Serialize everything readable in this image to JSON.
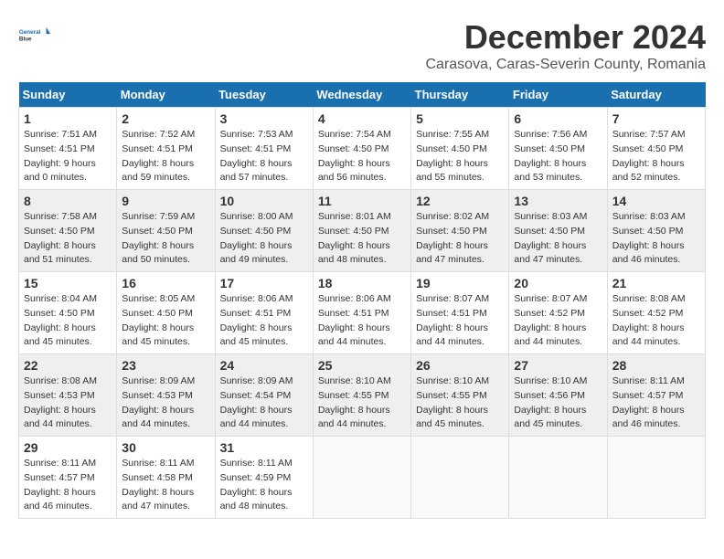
{
  "header": {
    "logo_line1": "General",
    "logo_line2": "Blue",
    "month": "December 2024",
    "location": "Carasova, Caras-Severin County, Romania"
  },
  "days_of_week": [
    "Sunday",
    "Monday",
    "Tuesday",
    "Wednesday",
    "Thursday",
    "Friday",
    "Saturday"
  ],
  "weeks": [
    [
      {
        "day": "1",
        "sunrise": "Sunrise: 7:51 AM",
        "sunset": "Sunset: 4:51 PM",
        "daylight": "Daylight: 9 hours and 0 minutes."
      },
      {
        "day": "2",
        "sunrise": "Sunrise: 7:52 AM",
        "sunset": "Sunset: 4:51 PM",
        "daylight": "Daylight: 8 hours and 59 minutes."
      },
      {
        "day": "3",
        "sunrise": "Sunrise: 7:53 AM",
        "sunset": "Sunset: 4:51 PM",
        "daylight": "Daylight: 8 hours and 57 minutes."
      },
      {
        "day": "4",
        "sunrise": "Sunrise: 7:54 AM",
        "sunset": "Sunset: 4:50 PM",
        "daylight": "Daylight: 8 hours and 56 minutes."
      },
      {
        "day": "5",
        "sunrise": "Sunrise: 7:55 AM",
        "sunset": "Sunset: 4:50 PM",
        "daylight": "Daylight: 8 hours and 55 minutes."
      },
      {
        "day": "6",
        "sunrise": "Sunrise: 7:56 AM",
        "sunset": "Sunset: 4:50 PM",
        "daylight": "Daylight: 8 hours and 53 minutes."
      },
      {
        "day": "7",
        "sunrise": "Sunrise: 7:57 AM",
        "sunset": "Sunset: 4:50 PM",
        "daylight": "Daylight: 8 hours and 52 minutes."
      }
    ],
    [
      {
        "day": "8",
        "sunrise": "Sunrise: 7:58 AM",
        "sunset": "Sunset: 4:50 PM",
        "daylight": "Daylight: 8 hours and 51 minutes."
      },
      {
        "day": "9",
        "sunrise": "Sunrise: 7:59 AM",
        "sunset": "Sunset: 4:50 PM",
        "daylight": "Daylight: 8 hours and 50 minutes."
      },
      {
        "day": "10",
        "sunrise": "Sunrise: 8:00 AM",
        "sunset": "Sunset: 4:50 PM",
        "daylight": "Daylight: 8 hours and 49 minutes."
      },
      {
        "day": "11",
        "sunrise": "Sunrise: 8:01 AM",
        "sunset": "Sunset: 4:50 PM",
        "daylight": "Daylight: 8 hours and 48 minutes."
      },
      {
        "day": "12",
        "sunrise": "Sunrise: 8:02 AM",
        "sunset": "Sunset: 4:50 PM",
        "daylight": "Daylight: 8 hours and 47 minutes."
      },
      {
        "day": "13",
        "sunrise": "Sunrise: 8:03 AM",
        "sunset": "Sunset: 4:50 PM",
        "daylight": "Daylight: 8 hours and 47 minutes."
      },
      {
        "day": "14",
        "sunrise": "Sunrise: 8:03 AM",
        "sunset": "Sunset: 4:50 PM",
        "daylight": "Daylight: 8 hours and 46 minutes."
      }
    ],
    [
      {
        "day": "15",
        "sunrise": "Sunrise: 8:04 AM",
        "sunset": "Sunset: 4:50 PM",
        "daylight": "Daylight: 8 hours and 45 minutes."
      },
      {
        "day": "16",
        "sunrise": "Sunrise: 8:05 AM",
        "sunset": "Sunset: 4:50 PM",
        "daylight": "Daylight: 8 hours and 45 minutes."
      },
      {
        "day": "17",
        "sunrise": "Sunrise: 8:06 AM",
        "sunset": "Sunset: 4:51 PM",
        "daylight": "Daylight: 8 hours and 45 minutes."
      },
      {
        "day": "18",
        "sunrise": "Sunrise: 8:06 AM",
        "sunset": "Sunset: 4:51 PM",
        "daylight": "Daylight: 8 hours and 44 minutes."
      },
      {
        "day": "19",
        "sunrise": "Sunrise: 8:07 AM",
        "sunset": "Sunset: 4:51 PM",
        "daylight": "Daylight: 8 hours and 44 minutes."
      },
      {
        "day": "20",
        "sunrise": "Sunrise: 8:07 AM",
        "sunset": "Sunset: 4:52 PM",
        "daylight": "Daylight: 8 hours and 44 minutes."
      },
      {
        "day": "21",
        "sunrise": "Sunrise: 8:08 AM",
        "sunset": "Sunset: 4:52 PM",
        "daylight": "Daylight: 8 hours and 44 minutes."
      }
    ],
    [
      {
        "day": "22",
        "sunrise": "Sunrise: 8:08 AM",
        "sunset": "Sunset: 4:53 PM",
        "daylight": "Daylight: 8 hours and 44 minutes."
      },
      {
        "day": "23",
        "sunrise": "Sunrise: 8:09 AM",
        "sunset": "Sunset: 4:53 PM",
        "daylight": "Daylight: 8 hours and 44 minutes."
      },
      {
        "day": "24",
        "sunrise": "Sunrise: 8:09 AM",
        "sunset": "Sunset: 4:54 PM",
        "daylight": "Daylight: 8 hours and 44 minutes."
      },
      {
        "day": "25",
        "sunrise": "Sunrise: 8:10 AM",
        "sunset": "Sunset: 4:55 PM",
        "daylight": "Daylight: 8 hours and 44 minutes."
      },
      {
        "day": "26",
        "sunrise": "Sunrise: 8:10 AM",
        "sunset": "Sunset: 4:55 PM",
        "daylight": "Daylight: 8 hours and 45 minutes."
      },
      {
        "day": "27",
        "sunrise": "Sunrise: 8:10 AM",
        "sunset": "Sunset: 4:56 PM",
        "daylight": "Daylight: 8 hours and 45 minutes."
      },
      {
        "day": "28",
        "sunrise": "Sunrise: 8:11 AM",
        "sunset": "Sunset: 4:57 PM",
        "daylight": "Daylight: 8 hours and 46 minutes."
      }
    ],
    [
      {
        "day": "29",
        "sunrise": "Sunrise: 8:11 AM",
        "sunset": "Sunset: 4:57 PM",
        "daylight": "Daylight: 8 hours and 46 minutes."
      },
      {
        "day": "30",
        "sunrise": "Sunrise: 8:11 AM",
        "sunset": "Sunset: 4:58 PM",
        "daylight": "Daylight: 8 hours and 47 minutes."
      },
      {
        "day": "31",
        "sunrise": "Sunrise: 8:11 AM",
        "sunset": "Sunset: 4:59 PM",
        "daylight": "Daylight: 8 hours and 48 minutes."
      },
      {
        "day": "",
        "sunrise": "",
        "sunset": "",
        "daylight": ""
      },
      {
        "day": "",
        "sunrise": "",
        "sunset": "",
        "daylight": ""
      },
      {
        "day": "",
        "sunrise": "",
        "sunset": "",
        "daylight": ""
      },
      {
        "day": "",
        "sunrise": "",
        "sunset": "",
        "daylight": ""
      }
    ]
  ]
}
